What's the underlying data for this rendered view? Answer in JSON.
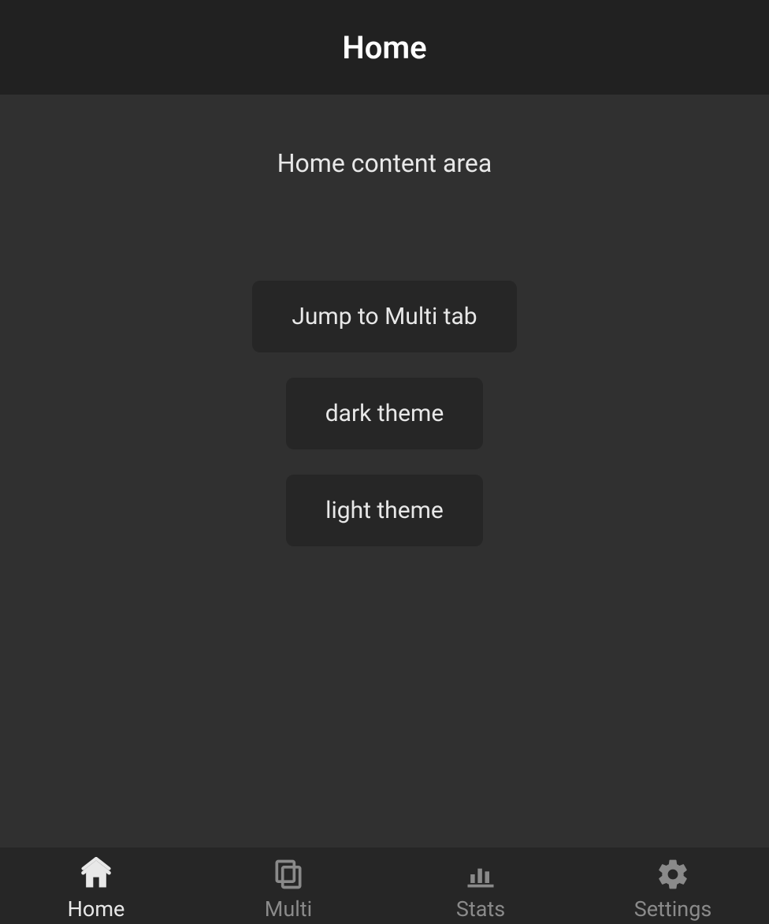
{
  "header": {
    "title": "Home"
  },
  "main": {
    "content_text": "Home content area",
    "buttons": {
      "jump_multi": "Jump to Multi tab",
      "dark_theme": "dark theme",
      "light_theme": "light theme"
    }
  },
  "tabs": [
    {
      "label": "Home",
      "icon": "home-icon",
      "active": true
    },
    {
      "label": "Multi",
      "icon": "multi-icon",
      "active": false
    },
    {
      "label": "Stats",
      "icon": "stats-icon",
      "active": false
    },
    {
      "label": "Settings",
      "icon": "settings-icon",
      "active": false
    }
  ]
}
